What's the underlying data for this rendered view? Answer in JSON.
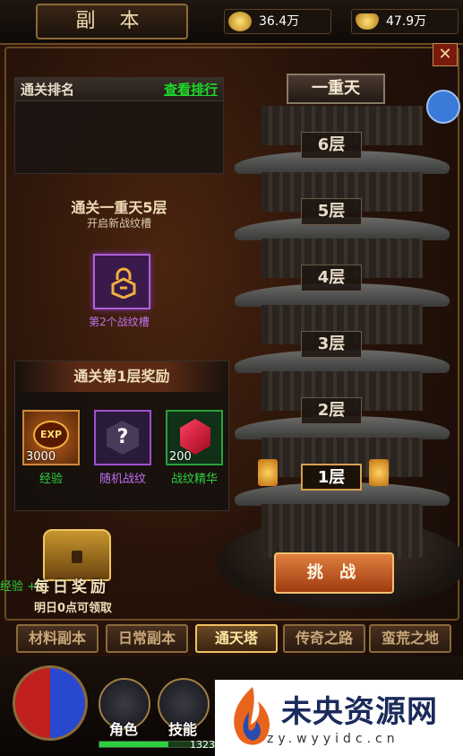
{
  "header": {
    "title": "副 本",
    "gold": "36.4万",
    "ingot": "47.9万"
  },
  "ranking": {
    "title": "通关排名",
    "view_link": "查看排行"
  },
  "unlock": {
    "title": "通关一重天5层",
    "subtitle": "开启新战纹槽",
    "slot_label": "第2个战纹槽"
  },
  "rewards": {
    "title": "通关第1层奖励",
    "items": [
      {
        "label": "经验",
        "count": "3000",
        "badge": "EXP"
      },
      {
        "label": "随机战纹",
        "count": "",
        "badge": "?"
      },
      {
        "label": "战纹精华",
        "count": "200",
        "badge": ""
      }
    ]
  },
  "daily": {
    "title": "每日奖励",
    "subtitle": "明日0点可领取",
    "hint": "经验 +3"
  },
  "tower": {
    "name": "一重天",
    "floors": [
      "6层",
      "5层",
      "4层",
      "3层",
      "2层",
      "1层"
    ],
    "active_floor": "1层"
  },
  "challenge_label": "挑 战",
  "tabs": [
    "材料副本",
    "日常副本",
    "通天塔",
    "传奇之路",
    "蛮荒之地"
  ],
  "active_tab": "通天塔",
  "bottom_nav": {
    "role": "角色",
    "skill": "技能",
    "exp_number": "1323"
  },
  "watermark": {
    "name": "未央资源网",
    "url": "zy.wyyidc.cn"
  },
  "colors": {
    "accent": "#f0c060",
    "link": "#1ed82c",
    "purple": "#b060d8"
  }
}
